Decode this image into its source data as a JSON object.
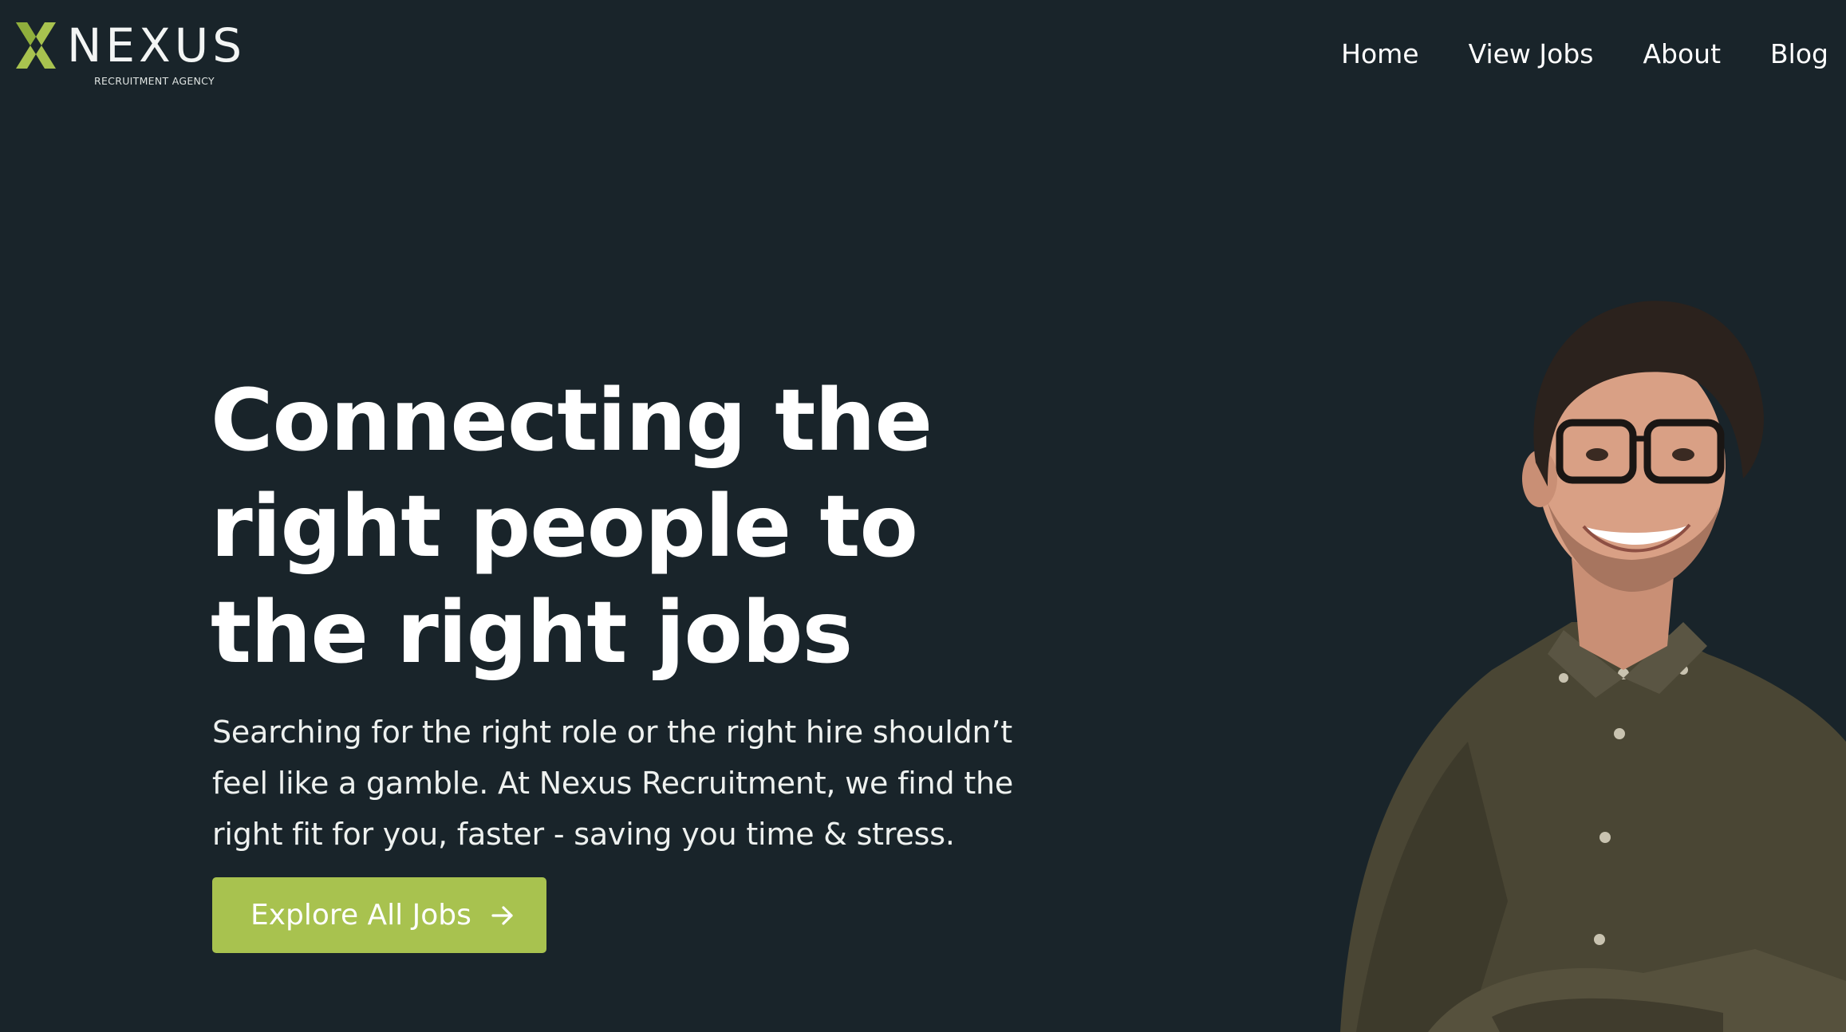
{
  "brand": {
    "name": "NEXUS",
    "tagline": "RECRUITMENT AGENCY",
    "accent_color": "#a8c24f",
    "background_color": "#19242a"
  },
  "nav": {
    "items": [
      {
        "label": "Home"
      },
      {
        "label": "View Jobs"
      },
      {
        "label": "About"
      },
      {
        "label": "Blog"
      }
    ]
  },
  "hero": {
    "title_lines": [
      "Connecting the",
      "right people to",
      "the right jobs"
    ],
    "subtitle_lines": [
      "Searching for the right role or the right hire shouldn’t",
      "feel like a gamble. At Nexus Recruitment, we find the",
      "right fit for you, faster - saving you time & stress."
    ],
    "cta_label": "Explore All Jobs",
    "cta_icon": "arrow-right-icon",
    "image_subject": "portrait-photo"
  }
}
